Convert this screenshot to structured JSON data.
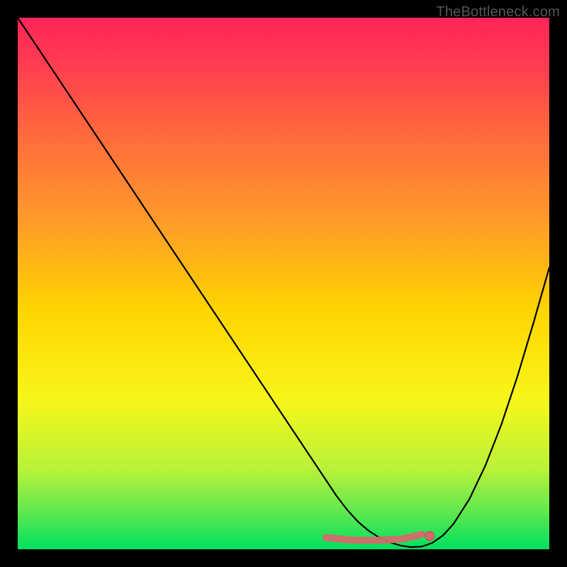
{
  "watermark": "TheBottleneck.com",
  "colors": {
    "gradient_top": "#ff2558",
    "gradient_mid": "#ffd400",
    "gradient_bottom": "#00e060",
    "curve": "#000000",
    "marker_fill": "#d46a6a",
    "marker_stroke": "#c05050",
    "frame": "#000000"
  },
  "chart_data": {
    "type": "line",
    "title": "",
    "xlabel": "",
    "ylabel": "",
    "xlim": [
      0,
      100
    ],
    "ylim": [
      0,
      100
    ],
    "x": [
      0,
      2,
      5,
      10,
      15,
      20,
      25,
      30,
      35,
      40,
      45,
      50,
      55,
      58,
      60,
      62,
      64,
      66,
      68,
      70,
      72,
      74,
      76,
      78,
      80,
      82,
      85,
      88,
      91,
      94,
      97,
      100
    ],
    "y": [
      100,
      97,
      92.5,
      85,
      77.5,
      70,
      62.5,
      55,
      47.5,
      40,
      32.5,
      25,
      17.5,
      13,
      10,
      7.4,
      5.2,
      3.5,
      2.2,
      1.3,
      0.7,
      0.4,
      0.5,
      1.2,
      2.6,
      4.8,
      9.5,
      15.8,
      23.5,
      32.5,
      42.5,
      53
    ],
    "markers": {
      "x": [
        58,
        60,
        62,
        64,
        66,
        68,
        70,
        72,
        74,
        76
      ],
      "y": [
        2.2,
        2.0,
        1.8,
        1.7,
        1.7,
        1.7,
        1.8,
        1.9,
        2.3,
        2.8
      ]
    }
  }
}
